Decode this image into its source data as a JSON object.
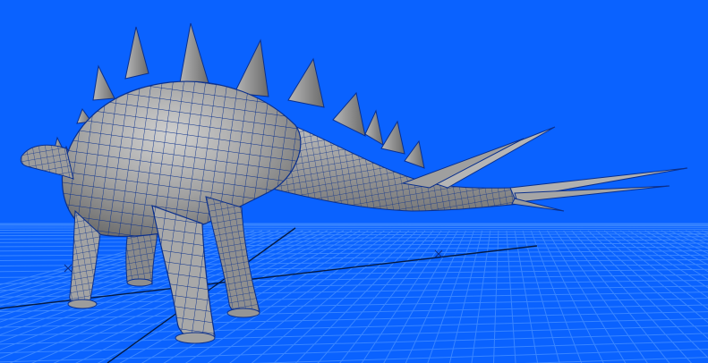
{
  "viewport": {
    "background_color": "#0a62ff",
    "grid_line_color": "#3a86ff",
    "grid_axis_color": "#041a44",
    "model": {
      "body_color": "#9a9a9a",
      "highlight_color": "#c9c9c9",
      "shadow_color": "#6f6f6f",
      "wireframe_color": "#0a2f8c"
    }
  }
}
